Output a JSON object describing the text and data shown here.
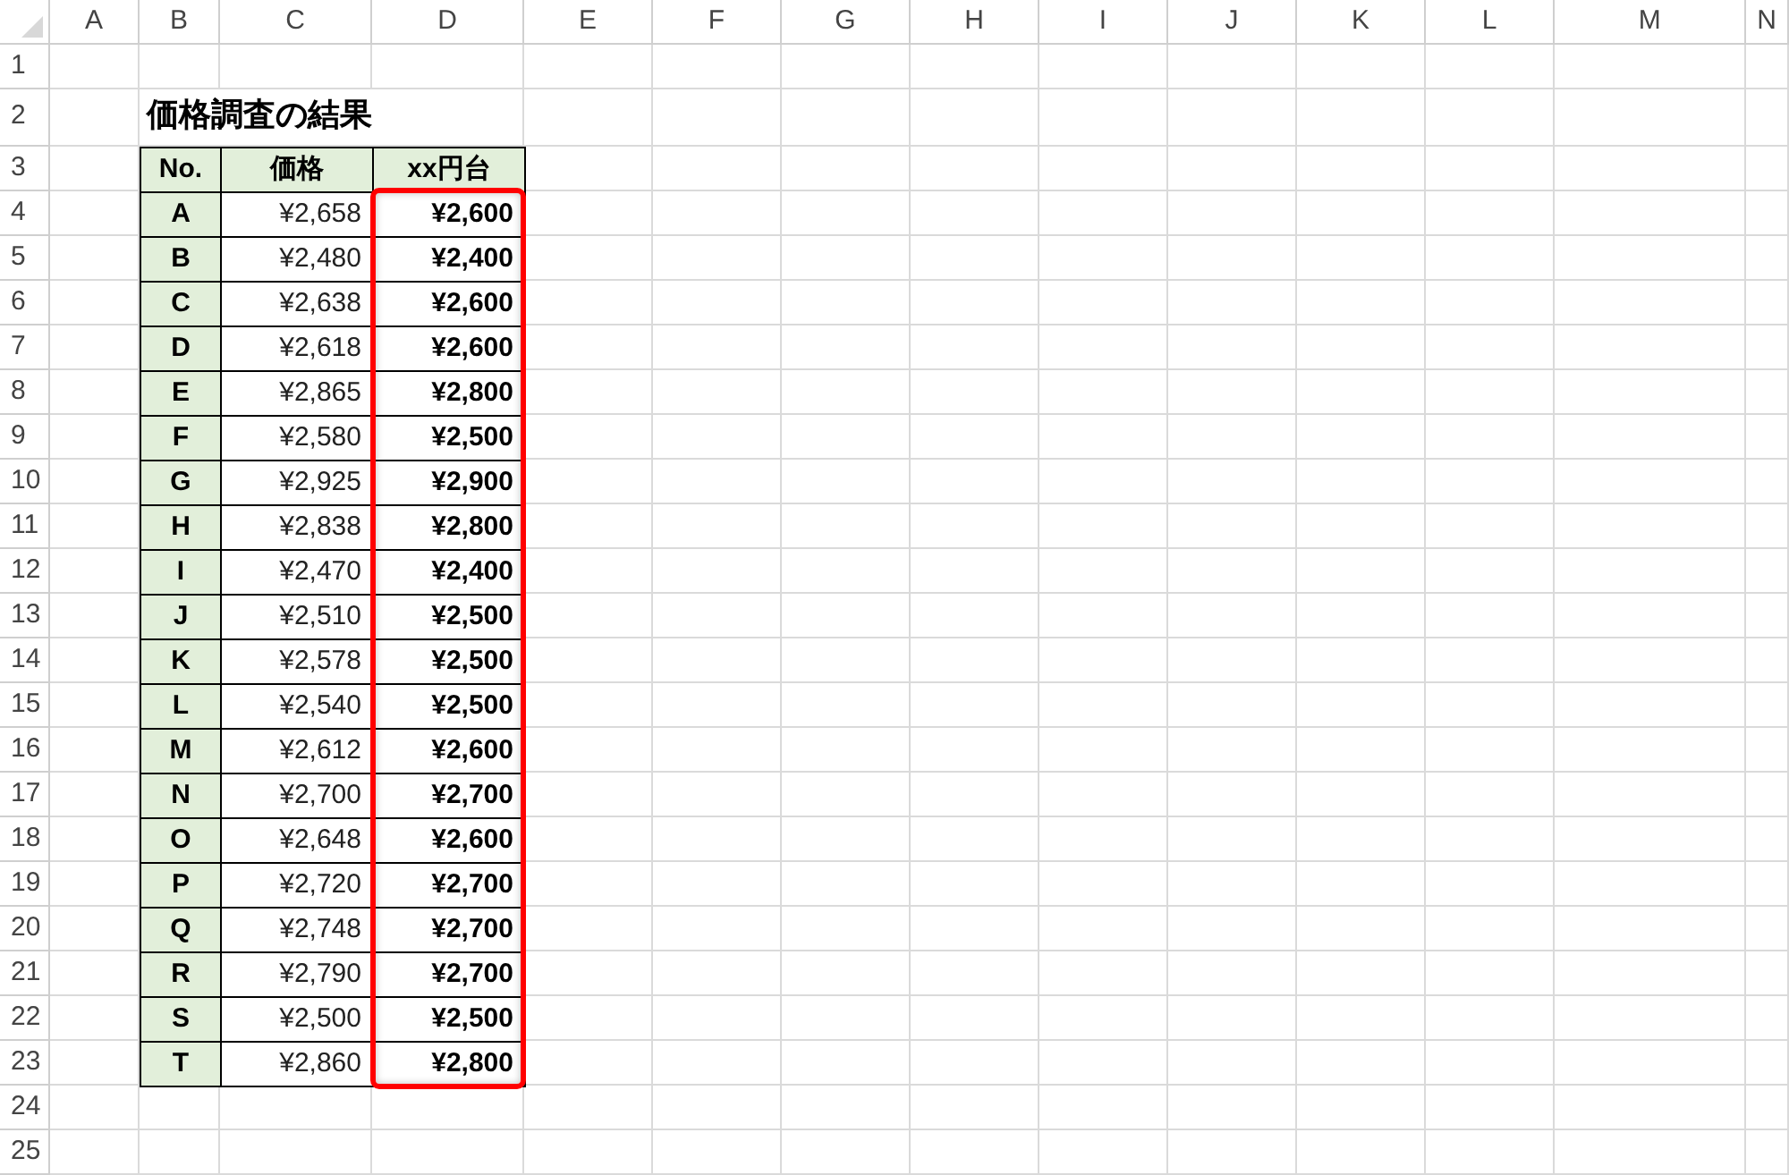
{
  "column_headers": [
    "A",
    "B",
    "C",
    "D",
    "E",
    "F",
    "G",
    "H",
    "I",
    "J",
    "K",
    "L",
    "M",
    "N"
  ],
  "row_numbers": [
    "1",
    "2",
    "3",
    "4",
    "5",
    "6",
    "7",
    "8",
    "9",
    "10",
    "11",
    "12",
    "13",
    "14",
    "15",
    "16",
    "17",
    "18",
    "19",
    "20",
    "21",
    "22",
    "23",
    "24",
    "25"
  ],
  "title": "価格調査の結果",
  "table": {
    "columns": [
      {
        "label": "No.",
        "highlighted": false
      },
      {
        "label": "価格",
        "highlighted": false
      },
      {
        "label": "xx円台",
        "highlighted": true
      }
    ],
    "rows": [
      {
        "no": "A",
        "price": "¥2,658",
        "rounded": "¥2,600"
      },
      {
        "no": "B",
        "price": "¥2,480",
        "rounded": "¥2,400"
      },
      {
        "no": "C",
        "price": "¥2,638",
        "rounded": "¥2,600"
      },
      {
        "no": "D",
        "price": "¥2,618",
        "rounded": "¥2,600"
      },
      {
        "no": "E",
        "price": "¥2,865",
        "rounded": "¥2,800"
      },
      {
        "no": "F",
        "price": "¥2,580",
        "rounded": "¥2,500"
      },
      {
        "no": "G",
        "price": "¥2,925",
        "rounded": "¥2,900"
      },
      {
        "no": "H",
        "price": "¥2,838",
        "rounded": "¥2,800"
      },
      {
        "no": "I",
        "price": "¥2,470",
        "rounded": "¥2,400"
      },
      {
        "no": "J",
        "price": "¥2,510",
        "rounded": "¥2,500"
      },
      {
        "no": "K",
        "price": "¥2,578",
        "rounded": "¥2,500"
      },
      {
        "no": "L",
        "price": "¥2,540",
        "rounded": "¥2,500"
      },
      {
        "no": "M",
        "price": "¥2,612",
        "rounded": "¥2,600"
      },
      {
        "no": "N",
        "price": "¥2,700",
        "rounded": "¥2,700"
      },
      {
        "no": "O",
        "price": "¥2,648",
        "rounded": "¥2,600"
      },
      {
        "no": "P",
        "price": "¥2,720",
        "rounded": "¥2,700"
      },
      {
        "no": "Q",
        "price": "¥2,748",
        "rounded": "¥2,700"
      },
      {
        "no": "R",
        "price": "¥2,790",
        "rounded": "¥2,700"
      },
      {
        "no": "S",
        "price": "¥2,500",
        "rounded": "¥2,500"
      },
      {
        "no": "T",
        "price": "¥2,860",
        "rounded": "¥2,800"
      }
    ]
  }
}
